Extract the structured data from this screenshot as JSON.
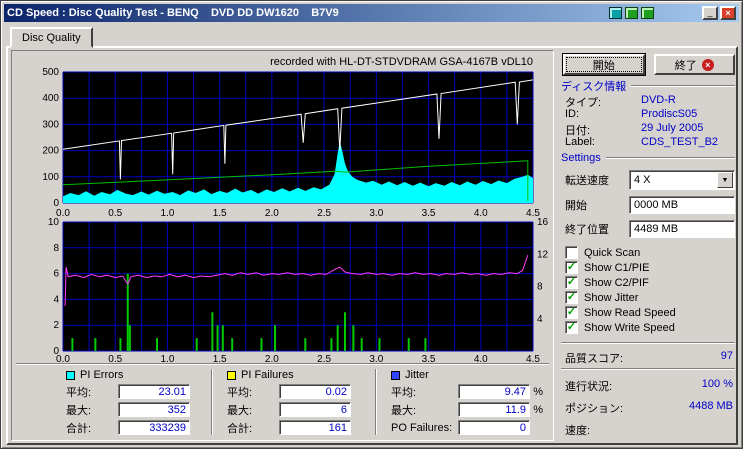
{
  "window": {
    "title": "CD Speed : Disc Quality Test - BENQ    DVD DD DW1620    B7V9"
  },
  "tab": {
    "label": "Disc Quality"
  },
  "chart_header": {
    "recorded_with": "recorded with HL-DT-STDVDRAM GSA-4167B vDL10"
  },
  "icons": {
    "close": "×",
    "minimize": "_",
    "dropdown_arrow": "▼",
    "check": "✓",
    "exit_badge": "×"
  },
  "colors": {
    "grid": "#0000c0",
    "plot_bg": "#000000",
    "accent_text": "#0000c8",
    "pi_errors": "#00ffff",
    "pi_failures_legend": "#ffff00",
    "jitter_legend": "#3344ff",
    "jitter_line": "#ff3cff",
    "pi_failure_bars": "#00cc00",
    "read_speed": "#00c000",
    "write_speed": "#ffffff"
  },
  "charts": {
    "top": {
      "type": "area",
      "x_min": 0,
      "x_max": 4.5,
      "y_min": 0,
      "y_max": 500,
      "grid_dx": 0.25,
      "grid_dy": 100,
      "x_ticks": [
        0,
        0.5,
        1,
        1.5,
        2,
        2.5,
        3,
        3.5,
        4,
        4.5
      ],
      "x_tick_labels": [
        "0.0",
        "0.5",
        "1.0",
        "1.5",
        "2.0",
        "2.5",
        "3.0",
        "3.5",
        "4.0",
        "4.5"
      ],
      "y_ticks": [
        0,
        100,
        200,
        300,
        400,
        500
      ],
      "y_tick_labels": [
        "0",
        "100",
        "200",
        "300",
        "400",
        "500"
      ],
      "series": [
        {
          "name": "pi-errors",
          "type": "area",
          "color": "#00ffff",
          "points": [
            [
              0,
              25
            ],
            [
              0.07,
              38
            ],
            [
              0.15,
              30
            ],
            [
              0.22,
              45
            ],
            [
              0.3,
              28
            ],
            [
              0.37,
              42
            ],
            [
              0.45,
              33
            ],
            [
              0.52,
              50
            ],
            [
              0.6,
              36
            ],
            [
              0.67,
              30
            ],
            [
              0.75,
              44
            ],
            [
              0.82,
              32
            ],
            [
              0.9,
              47
            ],
            [
              0.97,
              35
            ],
            [
              1.05,
              42
            ],
            [
              1.12,
              30
            ],
            [
              1.2,
              48
            ],
            [
              1.27,
              38
            ],
            [
              1.35,
              52
            ],
            [
              1.42,
              34
            ],
            [
              1.5,
              46
            ],
            [
              1.57,
              38
            ],
            [
              1.65,
              55
            ],
            [
              1.72,
              40
            ],
            [
              1.8,
              50
            ],
            [
              1.87,
              36
            ],
            [
              1.95,
              52
            ],
            [
              2.02,
              42
            ],
            [
              2.1,
              56
            ],
            [
              2.17,
              44
            ],
            [
              2.25,
              58
            ],
            [
              2.32,
              46
            ],
            [
              2.4,
              60
            ],
            [
              2.47,
              52
            ],
            [
              2.55,
              70
            ],
            [
              2.6,
              110
            ],
            [
              2.63,
              190
            ],
            [
              2.65,
              235
            ],
            [
              2.67,
              205
            ],
            [
              2.7,
              150
            ],
            [
              2.73,
              120
            ],
            [
              2.77,
              100
            ],
            [
              2.82,
              88
            ],
            [
              2.9,
              78
            ],
            [
              2.97,
              85
            ],
            [
              3.05,
              70
            ],
            [
              3.12,
              82
            ],
            [
              3.2,
              68
            ],
            [
              3.27,
              80
            ],
            [
              3.35,
              66
            ],
            [
              3.42,
              78
            ],
            [
              3.5,
              64
            ],
            [
              3.57,
              76
            ],
            [
              3.65,
              66
            ],
            [
              3.72,
              80
            ],
            [
              3.8,
              68
            ],
            [
              3.87,
              82
            ],
            [
              3.95,
              70
            ],
            [
              4.02,
              84
            ],
            [
              4.1,
              72
            ],
            [
              4.17,
              86
            ],
            [
              4.25,
              76
            ],
            [
              4.32,
              92
            ],
            [
              4.4,
              100
            ],
            [
              4.45,
              108
            ],
            [
              4.5,
              95
            ]
          ]
        },
        {
          "name": "read-speed",
          "type": "line",
          "color": "#00c000",
          "points": [
            [
              0,
              70
            ],
            [
              1,
              88
            ],
            [
              2,
              108
            ],
            [
              2.6,
              121
            ],
            [
              2.7,
              118
            ],
            [
              3.5,
              140
            ],
            [
              4.45,
              161
            ],
            [
              4.45,
              8
            ]
          ]
        },
        {
          "name": "write-speed",
          "type": "line",
          "color": "#ffffff",
          "points": [
            [
              0,
              205
            ],
            [
              0.54,
              237
            ],
            [
              0.55,
              90
            ],
            [
              0.56,
              238
            ],
            [
              1.04,
              266
            ],
            [
              1.05,
              110
            ],
            [
              1.06,
              267
            ],
            [
              1.54,
              296
            ],
            [
              1.55,
              150
            ],
            [
              1.56,
              297
            ],
            [
              2.28,
              339
            ],
            [
              2.3,
              230
            ],
            [
              2.32,
              341
            ],
            [
              2.63,
              360
            ],
            [
              2.65,
              200
            ],
            [
              2.67,
              362
            ],
            [
              3.58,
              416
            ],
            [
              3.6,
              245
            ],
            [
              3.62,
              418
            ],
            [
              4.33,
              461
            ],
            [
              4.35,
              300
            ],
            [
              4.37,
              462
            ],
            [
              4.5,
              470
            ]
          ]
        }
      ]
    },
    "bottom": {
      "type": "line",
      "x_min": 0,
      "x_max": 4.5,
      "y_min": 0,
      "y_max": 10,
      "y2_min": 0,
      "y2_max": 16,
      "grid_dx": 0.25,
      "grid_dy": 2,
      "x_ticks": [
        0,
        0.5,
        1,
        1.5,
        2,
        2.5,
        3,
        3.5,
        4,
        4.5
      ],
      "x_tick_labels": [
        "0.0",
        "0.5",
        "1.0",
        "1.5",
        "2.0",
        "2.5",
        "3.0",
        "3.5",
        "4.0",
        "4.5"
      ],
      "y_ticks": [
        0,
        2,
        4,
        6,
        8,
        10
      ],
      "y_tick_labels": [
        "0",
        "2",
        "4",
        "6",
        "8",
        "10"
      ],
      "y2_ticks": [
        4,
        8,
        12,
        16
      ],
      "y2_tick_labels": [
        "4",
        "8",
        "12",
        "16"
      ],
      "series": [
        {
          "name": "pi-failures",
          "type": "bars",
          "color": "#00cc00",
          "points": [
            [
              0.09,
              1
            ],
            [
              0.31,
              1
            ],
            [
              0.55,
              1
            ],
            [
              0.62,
              6
            ],
            [
              0.64,
              2
            ],
            [
              0.9,
              1
            ],
            [
              1.28,
              1
            ],
            [
              1.43,
              3
            ],
            [
              1.48,
              2
            ],
            [
              1.53,
              2
            ],
            [
              1.62,
              1
            ],
            [
              1.9,
              1
            ],
            [
              2.03,
              2
            ],
            [
              2.32,
              1
            ],
            [
              2.57,
              1
            ],
            [
              2.63,
              2
            ],
            [
              2.7,
              3
            ],
            [
              2.78,
              2
            ],
            [
              2.86,
              1
            ],
            [
              3.03,
              1
            ],
            [
              3.31,
              1
            ],
            [
              3.47,
              1
            ]
          ]
        },
        {
          "name": "jitter",
          "type": "line",
          "axis": "y2",
          "color": "#ff3cff",
          "points": [
            [
              0.02,
              5.6
            ],
            [
              0.03,
              10.4
            ],
            [
              0.05,
              9.2
            ],
            [
              0.12,
              9.4
            ],
            [
              0.2,
              9.1
            ],
            [
              0.27,
              9.5
            ],
            [
              0.35,
              9.2
            ],
            [
              0.42,
              9.4
            ],
            [
              0.5,
              9.1
            ],
            [
              0.57,
              9.3
            ],
            [
              0.62,
              8.3
            ],
            [
              0.65,
              9.2
            ],
            [
              0.72,
              9.4
            ],
            [
              0.8,
              9.1
            ],
            [
              0.87,
              9.3
            ],
            [
              0.95,
              9.2
            ],
            [
              1.02,
              9.5
            ],
            [
              1.1,
              9.2
            ],
            [
              1.17,
              9.4
            ],
            [
              1.25,
              9.1
            ],
            [
              1.32,
              9.3
            ],
            [
              1.4,
              9.2
            ],
            [
              1.47,
              9.4
            ],
            [
              1.55,
              9.6
            ],
            [
              1.62,
              9.4
            ],
            [
              1.7,
              9.7
            ],
            [
              1.77,
              9.5
            ],
            [
              1.85,
              9.7
            ],
            [
              1.92,
              9.4
            ],
            [
              2.0,
              9.6
            ],
            [
              2.07,
              9.5
            ],
            [
              2.15,
              9.7
            ],
            [
              2.22,
              9.5
            ],
            [
              2.3,
              9.6
            ],
            [
              2.37,
              9.4
            ],
            [
              2.45,
              9.6
            ],
            [
              2.52,
              9.5
            ],
            [
              2.6,
              10.1
            ],
            [
              2.65,
              10.4
            ],
            [
              2.7,
              9.8
            ],
            [
              2.77,
              9.6
            ],
            [
              2.85,
              9.5
            ],
            [
              2.92,
              9.7
            ],
            [
              3.0,
              9.5
            ],
            [
              3.07,
              9.6
            ],
            [
              3.15,
              9.4
            ],
            [
              3.22,
              9.6
            ],
            [
              3.3,
              9.5
            ],
            [
              3.37,
              9.7
            ],
            [
              3.45,
              9.5
            ],
            [
              3.52,
              9.6
            ],
            [
              3.6,
              9.4
            ],
            [
              3.67,
              9.6
            ],
            [
              3.75,
              9.5
            ],
            [
              3.82,
              9.7
            ],
            [
              3.9,
              9.5
            ],
            [
              3.97,
              9.6
            ],
            [
              4.05,
              9.4
            ],
            [
              4.12,
              9.6
            ],
            [
              4.2,
              9.5
            ],
            [
              4.27,
              9.7
            ],
            [
              4.35,
              9.6
            ],
            [
              4.4,
              10.0
            ],
            [
              4.45,
              11.9
            ]
          ]
        }
      ]
    }
  },
  "actions": {
    "start_label": "開始",
    "exit_label": "終了"
  },
  "disc_info": {
    "header": "ディスク情報",
    "type_label": "タイプ:",
    "type_value": "DVD-R",
    "id_label": "ID:",
    "id_value": "ProdiscS05",
    "date_label": "日付:",
    "date_value": "29 July 2005",
    "label_label": "Label:",
    "label_value": "CDS_TEST_B2"
  },
  "settings": {
    "header": "Settings",
    "speed_label": "転送速度",
    "speed_value": "4 X",
    "start_label": "開始",
    "start_value": "0000 MB",
    "end_label": "終了位置",
    "end_value": "4489 MB",
    "checkboxes": [
      {
        "label": "Quick Scan",
        "checked": false
      },
      {
        "label": "Show C1/PIE",
        "checked": true
      },
      {
        "label": "Show C2/PIF",
        "checked": true
      },
      {
        "label": "Show Jitter",
        "checked": true
      },
      {
        "label": "Show Read Speed",
        "checked": true
      },
      {
        "label": "Show Write Speed",
        "checked": true
      }
    ]
  },
  "score": {
    "label": "品質スコア:",
    "value": "97"
  },
  "progress": {
    "rows": [
      {
        "label": "進行状況:",
        "value": "100 %"
      },
      {
        "label": "ポジション:",
        "value": "4488 MB"
      },
      {
        "label": "速度:",
        "value": ""
      }
    ]
  },
  "stats": [
    {
      "title": "PI Errors",
      "swatch": "#00ffff",
      "rows": [
        {
          "label": "平均:",
          "value": "23.01",
          "unit": ""
        },
        {
          "label": "最大:",
          "value": "352",
          "unit": ""
        },
        {
          "label": "合計:",
          "value": "333239",
          "unit": ""
        }
      ]
    },
    {
      "title": "PI Failures",
      "swatch": "#ffff00",
      "rows": [
        {
          "label": "平均:",
          "value": "0.02",
          "unit": ""
        },
        {
          "label": "最大:",
          "value": "6",
          "unit": ""
        },
        {
          "label": "合計:",
          "value": "161",
          "unit": ""
        }
      ]
    },
    {
      "title": "Jitter",
      "swatch": "#3344ff",
      "rows": [
        {
          "label": "平均:",
          "value": "9.47",
          "unit": "%"
        },
        {
          "label": "最大:",
          "value": "11.9",
          "unit": "%"
        },
        {
          "label": "PO Failures:",
          "value": "0",
          "unit": ""
        }
      ]
    }
  ]
}
